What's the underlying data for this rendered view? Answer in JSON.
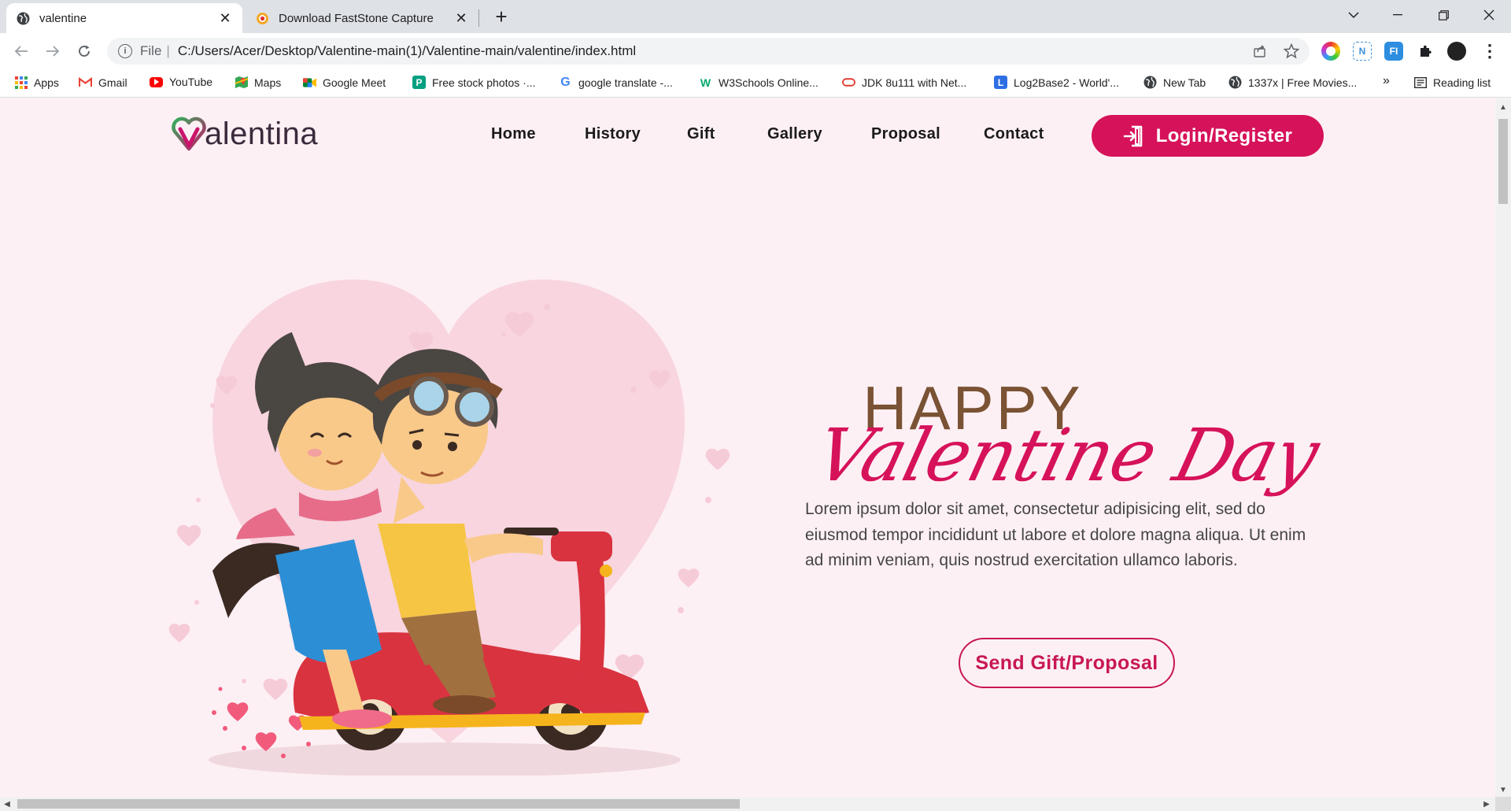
{
  "browser": {
    "tabs": [
      {
        "title": "valentine",
        "active": true
      },
      {
        "title": "Download FastStone Capture",
        "active": false
      }
    ],
    "address": {
      "scheme": "File",
      "path": "C:/Users/Acer/Desktop/Valentine-main(1)/Valentine-main/valentine/index.html"
    },
    "bookmarks": [
      {
        "label": "Apps",
        "icon": "apps-grid-icon"
      },
      {
        "label": "Gmail",
        "icon": "gmail-icon"
      },
      {
        "label": "YouTube",
        "icon": "youtube-icon"
      },
      {
        "label": "Maps",
        "icon": "maps-icon"
      },
      {
        "label": "Google Meet",
        "icon": "meet-icon"
      },
      {
        "label": "Free stock photos ·...",
        "icon": "pexels-icon"
      },
      {
        "label": "google translate -...",
        "icon": "google-icon"
      },
      {
        "label": "W3Schools Online...",
        "icon": "w3schools-icon"
      },
      {
        "label": "JDK 8u111 with Net...",
        "icon": "oracle-icon"
      },
      {
        "label": "Log2Base2 - World'...",
        "icon": "log2base2-icon"
      },
      {
        "label": "New Tab",
        "icon": "globe-icon"
      },
      {
        "label": "1337x | Free Movies...",
        "icon": "globe-icon"
      }
    ],
    "overflow": "»",
    "reading_list": "Reading list"
  },
  "site": {
    "logo_text": "alentina",
    "nav": [
      "Home",
      "History",
      "Gift",
      "Gallery",
      "Proposal",
      "Contact"
    ],
    "login_label": "Login/Register",
    "hero": {
      "happy": "HAPPY",
      "title": "Valentine Day",
      "body": "Lorem ipsum dolor sit amet, consectetur adipisicing elit, sed do eiusmod tempor incididunt ut labore et dolore magna aliqua. Ut enim ad minim veniam, quis nostrud exercitation ullamco laboris.",
      "cta": "Send Gift/Proposal"
    }
  },
  "colors": {
    "accent": "#d6125a",
    "brown": "#7a5234",
    "page_bg": "#fdf0f4"
  }
}
